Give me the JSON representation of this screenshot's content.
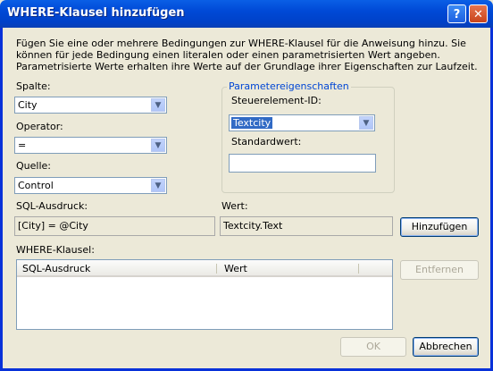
{
  "window": {
    "title": "WHERE-Klausel hinzufügen",
    "help_glyph": "?",
    "close_glyph": "✕"
  },
  "intro_text": "Fügen Sie eine oder mehrere Bedingungen zur WHERE-Klausel für die Anweisung hinzu. Sie können für jede Bedingung einen literalen oder einen parametrisierten Wert angeben. Parametrisierte Werte erhalten ihre Werte auf der Grundlage ihrer Eigenschaften zur Laufzeit.",
  "spalte": {
    "label": "Spalte:",
    "value": "City"
  },
  "operator": {
    "label": "Operator:",
    "value": "="
  },
  "quelle": {
    "label": "Quelle:",
    "value": "Control"
  },
  "param_group": {
    "title": "Parametereigenschaften",
    "control_id_label": "Steuerelement-ID:",
    "control_id_value": "Textcity",
    "default_label": "Standardwert:",
    "default_value": ""
  },
  "sql_expr": {
    "label": "SQL-Ausdruck:",
    "value": "[City] = @City"
  },
  "wert": {
    "label": "Wert:",
    "value": "Textcity.Text"
  },
  "buttons": {
    "add": "Hinzufügen",
    "remove": "Entfernen",
    "ok": "OK",
    "cancel": "Abbrechen"
  },
  "where_clause": {
    "label": "WHERE-Klausel:",
    "columns": [
      "SQL-Ausdruck",
      "Wert"
    ],
    "rows": []
  }
}
